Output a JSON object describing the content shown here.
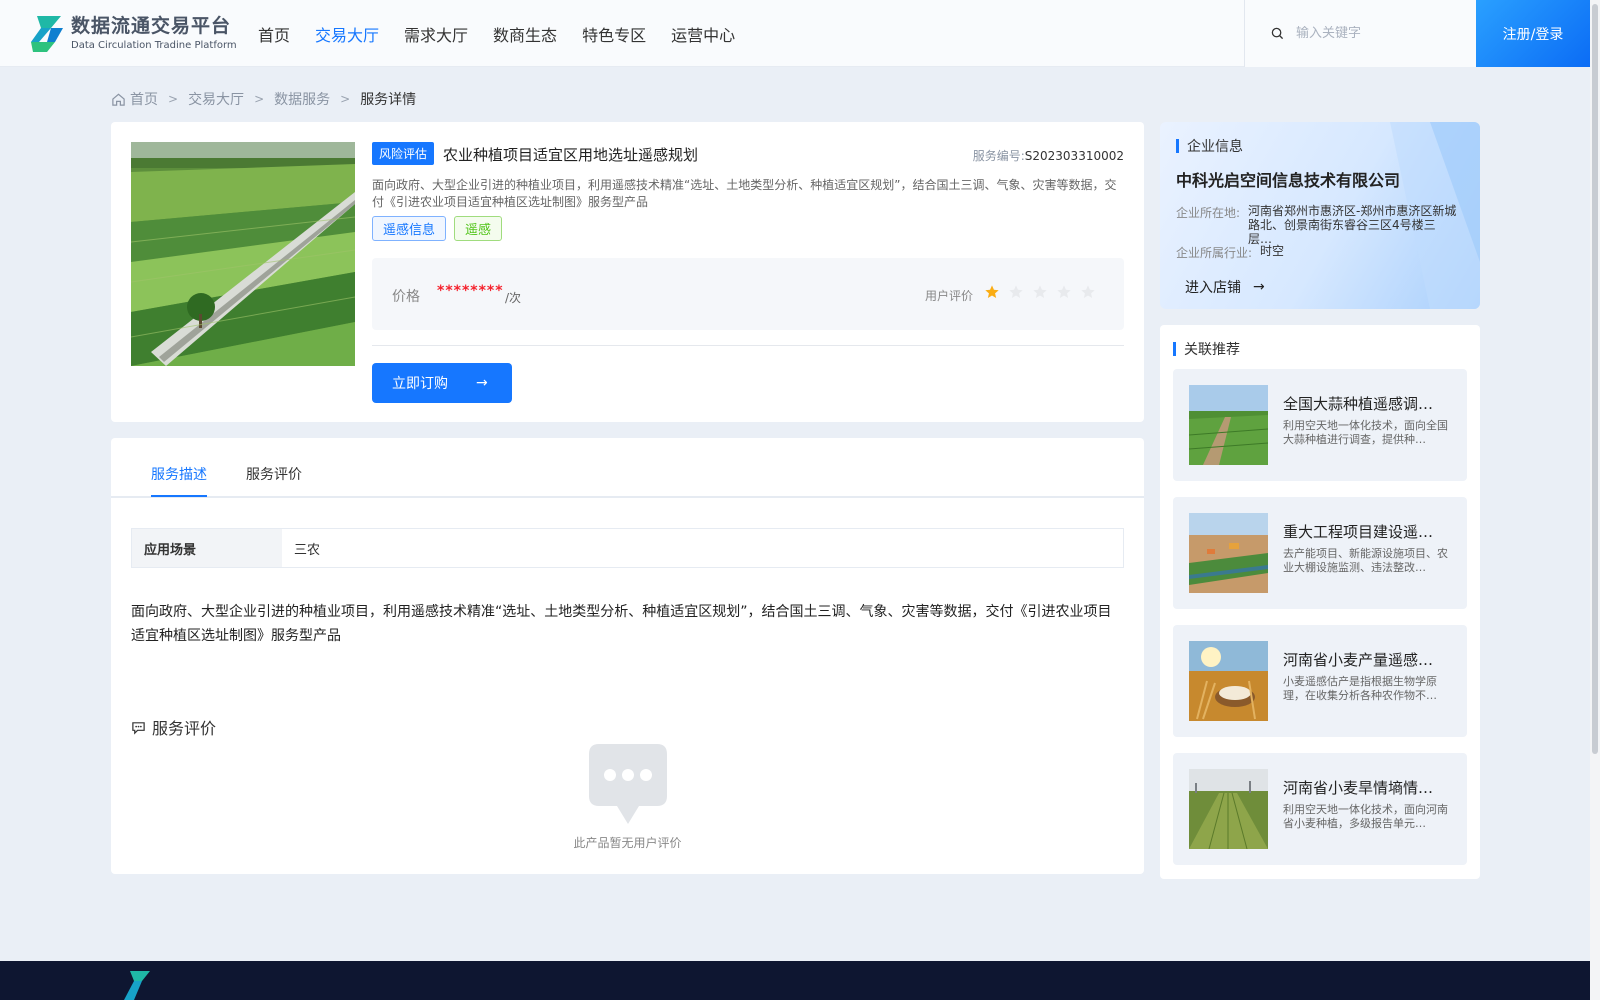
{
  "header": {
    "logo_cn": "数据流通交易平台",
    "logo_en": "Data Circulation Tradine Platform",
    "nav": [
      "首页",
      "交易大厅",
      "需求大厅",
      "数商生态",
      "特色专区",
      "运营中心"
    ],
    "nav_active": "交易大厅",
    "search_placeholder": "输入关键字",
    "login_label": "注册/登录",
    "brand_color": "#1677ff"
  },
  "breadcrumb": [
    "首页",
    "交易大厅",
    "数据服务",
    "服务详情"
  ],
  "product": {
    "category_tag": "风险评估",
    "title": "农业种植项目适宜区用地选址遥感规划",
    "service_no_label": "服务编号:",
    "service_no": "S202303310002",
    "description": "面向政府、大型企业引进的种植业项目，利用遥感技术精准“选址、土地类型分析、种植适宜区规划”，结合国土三调、气象、灾害等数据，交付《引进农业项目适宜种植区选址制图》服务型产品",
    "tags": [
      "遥感信息",
      "遥感"
    ],
    "price_label": "价格",
    "price_value": "********",
    "price_unit": "/次",
    "rating_label": "用户评价",
    "rating": 1,
    "rating_max": 5,
    "buy_label": "立即订购"
  },
  "tabs": {
    "items": [
      "服务描述",
      "服务评价"
    ],
    "active": "服务描述"
  },
  "details": {
    "scene_label": "应用场景",
    "scene_value": "三农",
    "full_description": "面向政府、大型企业引进的种植业项目，利用遥感技术精准“选址、土地类型分析、种植适宜区规划”，结合国土三调、气象、灾害等数据，交付《引进农业项目适宜种植区选址制图》服务型产品",
    "review_title": "服务评价",
    "empty_review": "此产品暂无用户评价"
  },
  "company": {
    "section_title": "企业信息",
    "name": "中科光启空间信息技术有限公司",
    "location_label": "企业所在地:",
    "location": "河南省郑州市惠济区-郑州市惠济区新城路北、创景南街东睿谷三区4号楼三层…",
    "industry_label": "企业所属行业:",
    "industry": "时空",
    "enter_shop": "进入店铺"
  },
  "related": {
    "section_title": "关联推荐",
    "items": [
      {
        "title": "全国大蒜种植遥感调…",
        "desc": "利用空天地一体化技术，面向全国大蒜种植进行调查，提供种…"
      },
      {
        "title": "重大工程项目建设遥…",
        "desc": "去产能项目、新能源设施项目、农业大棚设施监测、违法整改…"
      },
      {
        "title": "河南省小麦产量遥感…",
        "desc": "小麦遥感估产是指根据生物学原理，在收集分析各种农作物不…"
      },
      {
        "title": "河南省小麦旱情墒情…",
        "desc": "利用空天地一体化技术，面向河南省小麦种植，多级报告单元…"
      }
    ]
  }
}
